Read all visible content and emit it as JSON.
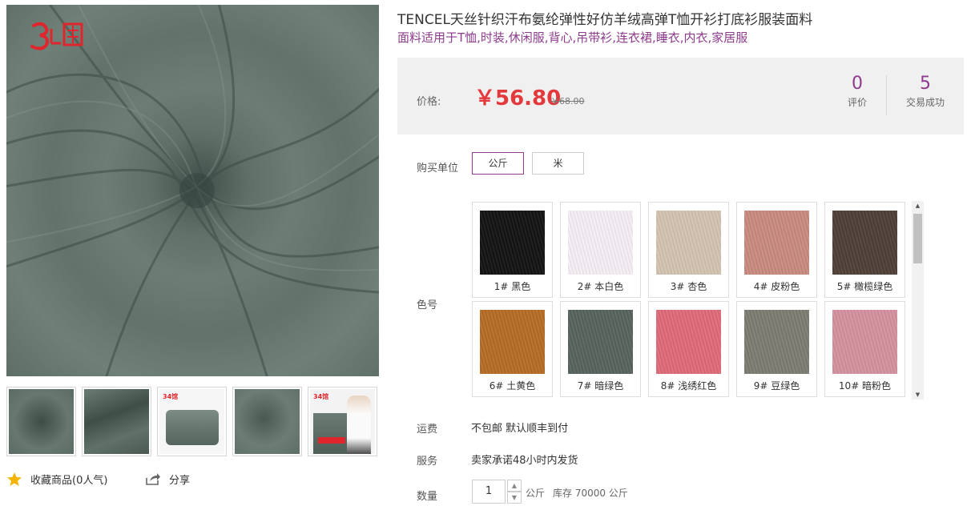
{
  "product": {
    "title": "TENCEL天丝针织汗布氨纶弹性好仿羊绒高弹T恤开衫打底衫服装面料",
    "subtitle": "面料适用于T恤,时装,休闲服,背心,吊带衫,连衣裙,睡衣,内衣,家居服"
  },
  "gallery": {
    "logo_text": "34馆",
    "thumbnails": [
      {
        "name": "swirl-dark",
        "color": "#5a6b63"
      },
      {
        "name": "draped",
        "color": "#4f5f58"
      },
      {
        "name": "folded-roll",
        "color": "#5d6e66"
      },
      {
        "name": "swirl-light",
        "color": "#66786f"
      },
      {
        "name": "model",
        "color": "#59695f"
      }
    ]
  },
  "actions": {
    "favorite_label": "收藏商品(0人气)",
    "share_label": "分享"
  },
  "price": {
    "label": "价格:",
    "current": "￥56.80",
    "original": "￥68.00"
  },
  "stats": {
    "reviews_count": "0",
    "reviews_label": "评价",
    "sales_count": "5",
    "sales_label": "交易成功"
  },
  "purchase_unit": {
    "label": "购买单位",
    "options": [
      "公斤",
      "米"
    ],
    "selected": "公斤"
  },
  "colors": {
    "label": "色号",
    "items": [
      {
        "name": "1# 黑色",
        "color": "#131313"
      },
      {
        "name": "2# 本白色",
        "color": "#f5eef5"
      },
      {
        "name": "3# 杏色",
        "color": "#d4c3b2"
      },
      {
        "name": "4# 皮粉色",
        "color": "#c98a80"
      },
      {
        "name": "5# 橄榄绿色",
        "color": "#4f4037"
      },
      {
        "name": "6# 土黄色",
        "color": "#b66c25"
      },
      {
        "name": "7# 暗绿色",
        "color": "#56635c"
      },
      {
        "name": "8# 浅绣红色",
        "color": "#e06a78"
      },
      {
        "name": "9# 豆绿色",
        "color": "#7c7c72"
      },
      {
        "name": "10# 暗粉色",
        "color": "#d5919e"
      }
    ]
  },
  "shipping": {
    "label": "运费",
    "value": "不包邮 默认顺丰到付"
  },
  "service": {
    "label": "服务",
    "value": "卖家承诺48小时内发货"
  },
  "quantity": {
    "label": "数量",
    "value": "1",
    "unit": "公斤",
    "stock": "库存 70000 公斤"
  }
}
